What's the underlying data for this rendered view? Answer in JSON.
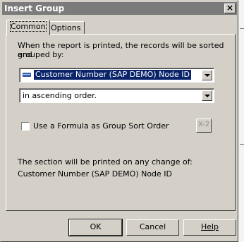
{
  "window": {
    "title": "Insert Group",
    "close_label": "×"
  },
  "tabs": [
    {
      "label": "Common"
    },
    {
      "label": "Options"
    }
  ],
  "common": {
    "description_line1": "When the report is printed, the records will be sorted and",
    "description_line2": "grouped by:",
    "group_field": {
      "value": "Customer Number (SAP DEMO) Node ID",
      "icon": "field-icon"
    },
    "sort_order": {
      "value": "in ascending order."
    },
    "use_formula": {
      "label": "Use a Formula as Group Sort Order",
      "checked": false
    },
    "formula_button": {
      "label": "X-2",
      "icon": "formula-icon"
    },
    "print_note_line1": "The section will be printed on any change of:",
    "print_note_line2": "Customer Number (SAP DEMO) Node ID"
  },
  "buttons": {
    "ok": "OK",
    "cancel": "Cancel",
    "help": "Help"
  },
  "colors": {
    "dialog_face": "#d4d0c8",
    "titlebar": "#7b7b7b",
    "selection": "#0a246a"
  }
}
